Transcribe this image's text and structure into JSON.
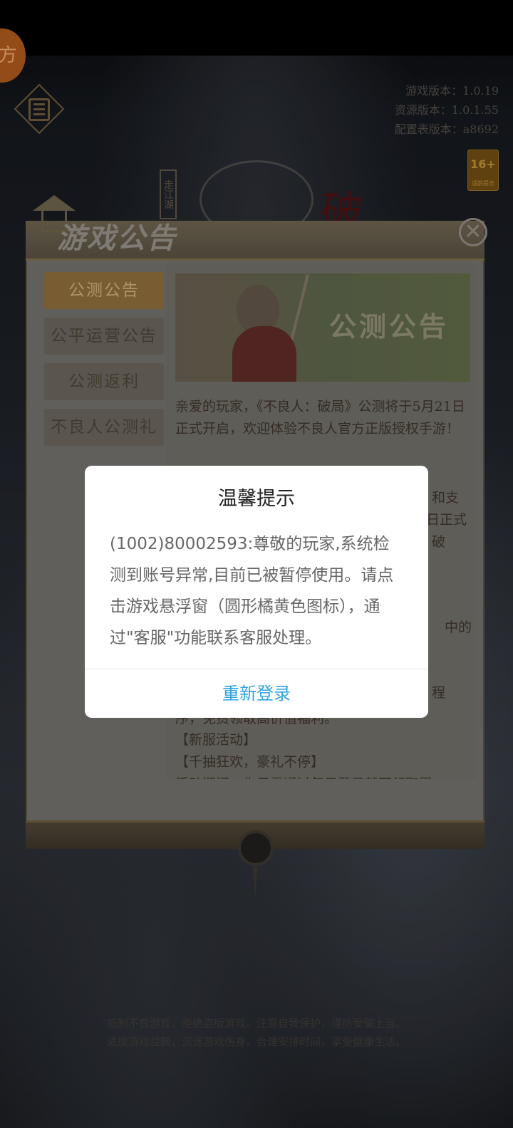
{
  "floating_ball": {
    "label": "方"
  },
  "version": {
    "game": "游戏版本：1.0.19",
    "resource": "资源版本：1.0.1.55",
    "config": "配置表版本：a8692"
  },
  "age_rating": {
    "value": "16+",
    "label": "适龄提示"
  },
  "logo": {
    "side_text": "走江湖",
    "char": "破"
  },
  "notice": {
    "title": "游戏公告",
    "close_symbol": "✕",
    "tabs": [
      "公测公告",
      "公平运营公告",
      "公测返利",
      "不良人公测礼"
    ],
    "active_tab": 0,
    "banner_text": "公测公告",
    "article_intro": "亲爱的玩家，《不良人：破局》公测将于5月21日正式开启，欢迎体验不良人官方正版授权手游！",
    "fragments": {
      "f1": "和支",
      "f2": "日正式",
      "f3": "破",
      "f4": "中的",
      "f5": "程",
      "f6": "序，免费领取高价值福利。",
      "f7": "【新服活动】",
      "f8": "【千抽狂欢，豪礼不停】",
      "f9": "活动期间，你只需通过每日登录就可领取累"
    }
  },
  "health_tips": {
    "line1": "抵制不良游戏，拒绝盗版游戏。注意自我保护，谨防受骗上当。",
    "line2": "适度游戏益脑，沉迷游戏伤身。合理安排时间，享受健康生活。"
  },
  "dialog": {
    "title": "温馨提示",
    "message": "(1002)80002593:尊敬的玩家,系统检测到账号异常,目前已被暂停使用。请点击游戏悬浮窗（圆形橘黄色图标），通过\"客服\"功能联系客服处理。",
    "button": "重新登录"
  },
  "colors": {
    "dialog_button": "#2ea4e3",
    "dialog_title": "#222222",
    "dialog_text": "#666666"
  }
}
